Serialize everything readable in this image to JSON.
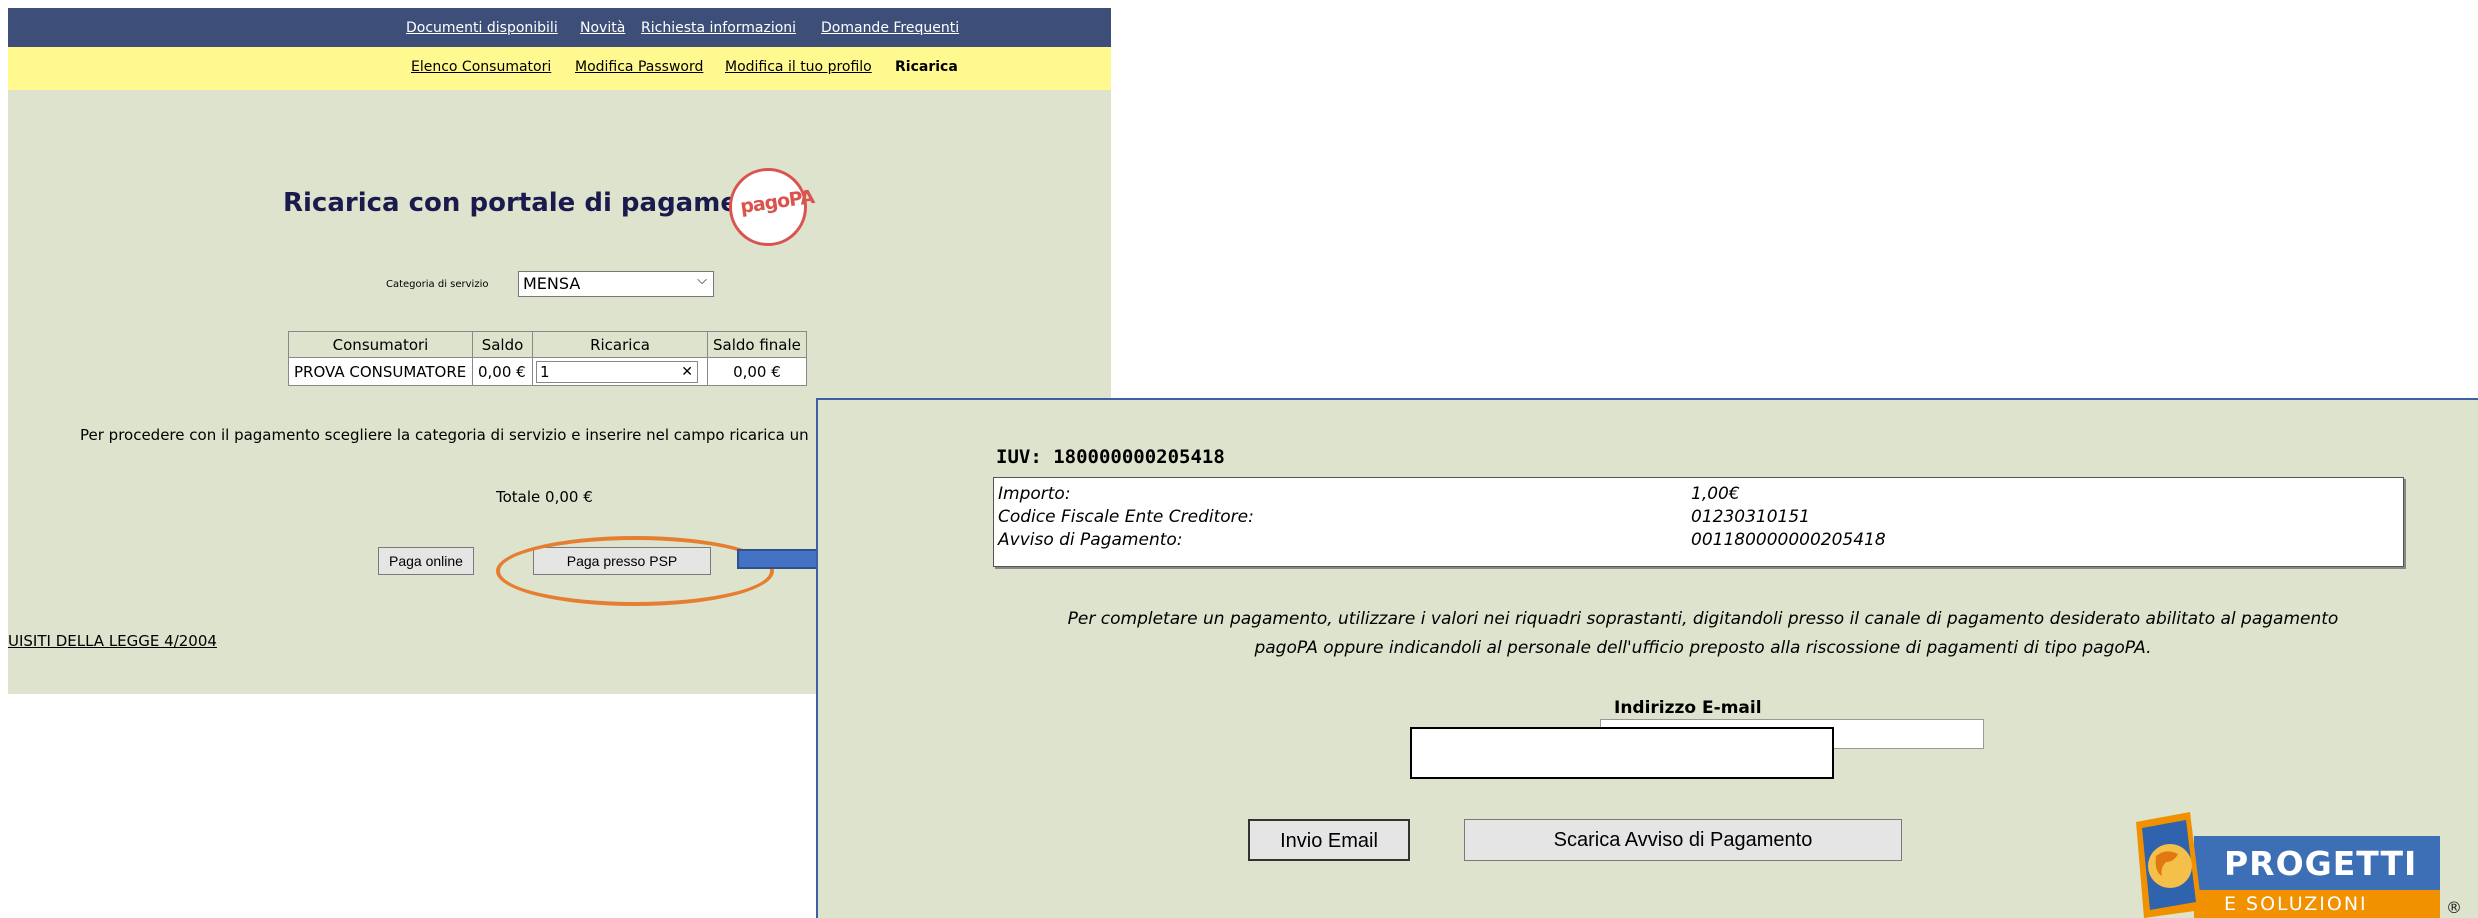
{
  "nav_top": {
    "links": [
      "Documenti disponibili",
      "Novità",
      "Richiesta informazioni",
      "Domande Frequenti"
    ]
  },
  "nav_sub": {
    "links": [
      "Elenco Consumatori",
      "Modifica Password",
      "Modifica il tuo profilo"
    ],
    "active": "Ricarica"
  },
  "page": {
    "title": "Ricarica con portale di pagamento",
    "logo_text": "pagoPA",
    "category_label": "Categoria di servizio",
    "category_value": "MENSA"
  },
  "table": {
    "headers": [
      "Consumatori",
      "Saldo",
      "Ricarica",
      "Saldo finale"
    ],
    "row": {
      "consumer": "PROVA CONSUMATORE",
      "saldo": "0,00 €",
      "ricarica": "1",
      "saldo_finale": "0,00 €"
    }
  },
  "instructions": "Per procedere con il pagamento scegliere la categoria di servizio e inserire nel campo ricarica un",
  "total": {
    "label": "Totale",
    "value": "0,00 €"
  },
  "buttons": {
    "paga_online": "Paga online",
    "paga_psp": "Paga presso PSP"
  },
  "law_link": "UISITI DELLA LEGGE 4/2004",
  "psp": {
    "iuv_title": "IUV: 180000000205418",
    "fields": [
      {
        "label": "Importo:",
        "value": "1,00€"
      },
      {
        "label": "Codice Fiscale Ente Creditore:",
        "value": "01230310151"
      },
      {
        "label": "Avviso di Pagamento:",
        "value": "001180000000205418"
      }
    ],
    "note_line1": "Per completare un pagamento, utilizzare i valori nei riquadri soprastanti, digitandoli presso il canale di pagamento desiderato abilitato al pagamento",
    "note_line2": "pagoPA oppure indicandoli al personale dell'ufficio preposto alla riscossione di pagamenti di tipo pagoPA.",
    "email_label": "Indirizzo E-mail",
    "btn_invio": "Invio Email",
    "btn_scarica": "Scarica Avviso di Pagamento"
  },
  "brand": {
    "name": "PROGETTI",
    "sub": "E SOLUZIONI",
    "reg": "®"
  },
  "colors": {
    "nav_blue": "#3d4f78",
    "nav_yellow": "#fff98f",
    "panel_bg": "#dde3cc",
    "highlight": "#e67e32",
    "arrow": "#4472c4",
    "pagopa_red": "#d9534f"
  }
}
